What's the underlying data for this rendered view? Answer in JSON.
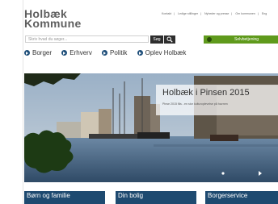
{
  "logo": {
    "line1": "Holbæk",
    "line2": "Kommune"
  },
  "top_links": [
    "Kontakt",
    "Ledige stillinger",
    "Nyheder og presse",
    "Om kommunen",
    "Eng"
  ],
  "search": {
    "placeholder": "Skriv hvad du søger...",
    "button_label": "Søg"
  },
  "selfservice": {
    "label": "Selvbetjening"
  },
  "nav": {
    "items": [
      "Borger",
      "Erhverv",
      "Politik",
      "Oplev Holbæk"
    ]
  },
  "hero": {
    "title": "Holbæk i Pinsen 2015",
    "subtitle": "Pinse 2015 fås - en stor kulturoplevelse på havnen"
  },
  "tiles": [
    "Børn og familie",
    "Din bolig",
    "Borgerservice"
  ],
  "colors": {
    "navy": "#1e4a70",
    "green": "#5f9a1c",
    "dark": "#2e2e2e"
  }
}
